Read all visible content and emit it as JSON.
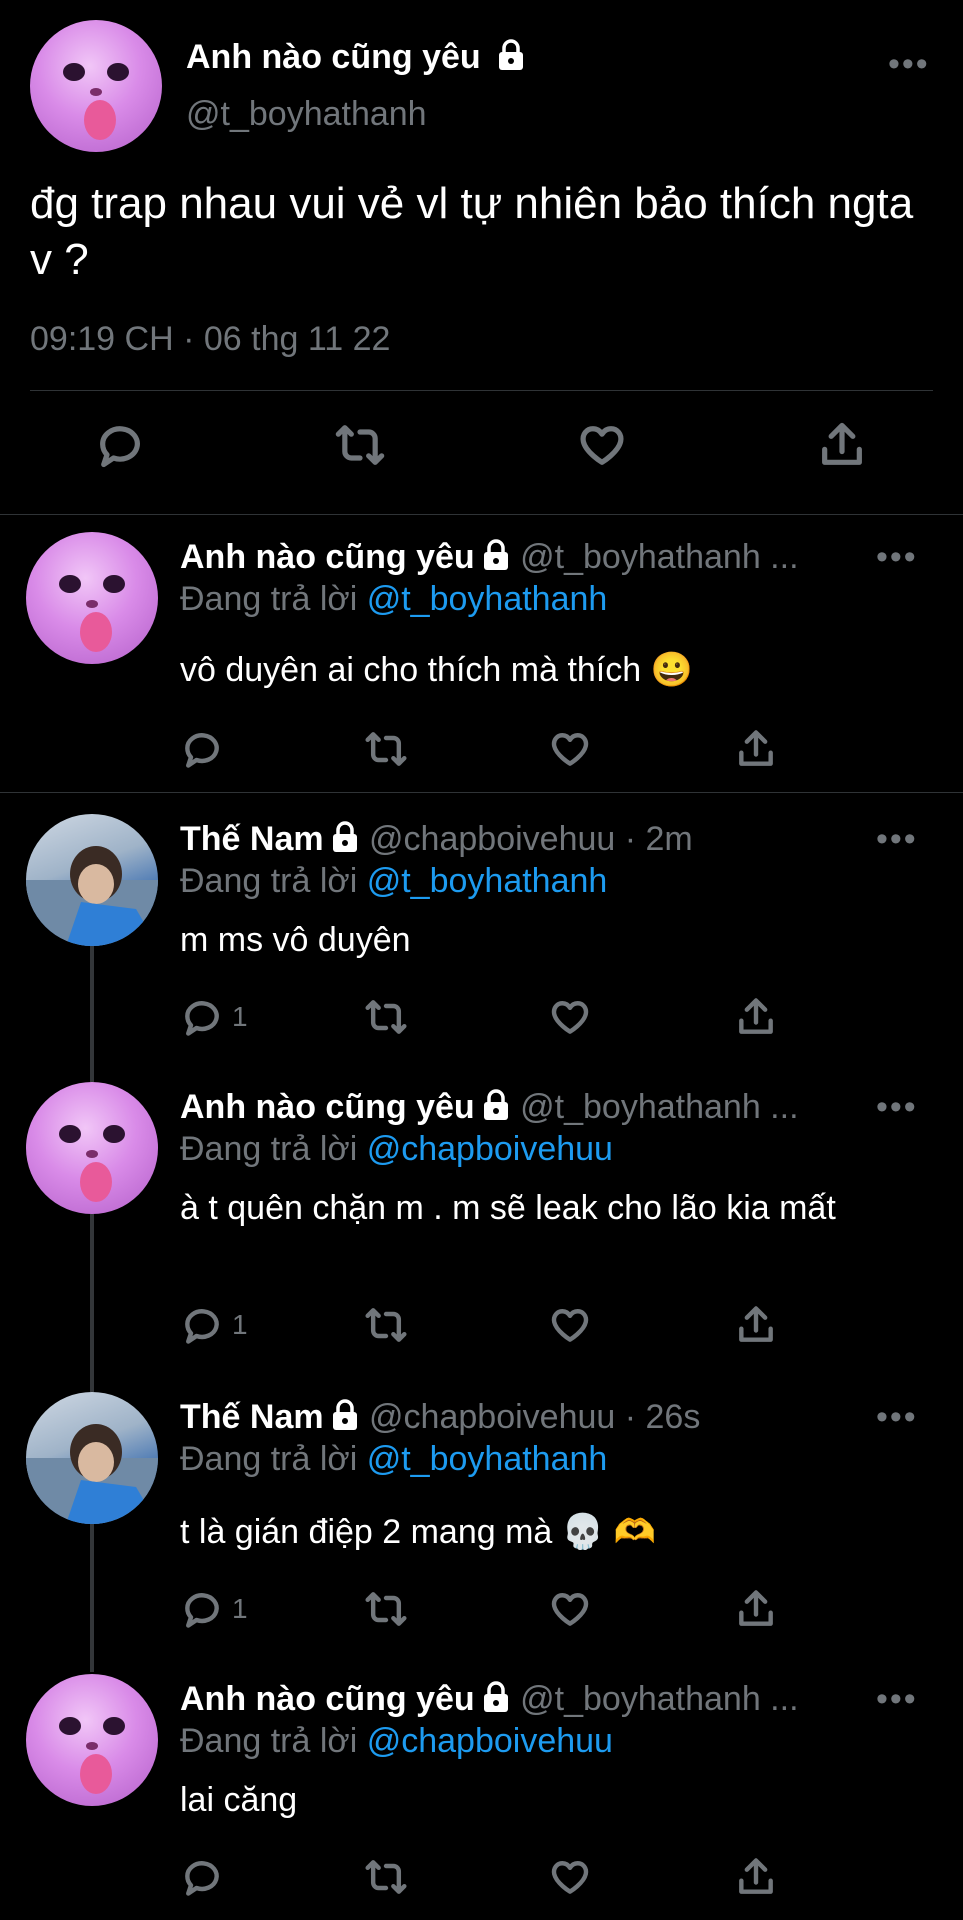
{
  "main_tweet": {
    "author_name": "Anh nào cũng yêu",
    "author_handle": "@t_boyhathanh",
    "text": "đg trap nhau vui vẻ vl tự nhiên bảo thích ngta v ?",
    "timestamp": "09:19 CH · 06 thg 11 22",
    "more": "•••"
  },
  "replies": [
    {
      "author_name": "Anh nào cũng yêu",
      "author_handle": "@t_boyhathanh ...",
      "time": "",
      "replying_prefix": "Đang trả lời",
      "replying_to": "@t_boyhathanh",
      "text": "vô duyên ai cho thích mà thích 😀",
      "reply_count": "",
      "more": "•••"
    },
    {
      "author_name": "Thế Nam",
      "author_handle": "@chapboivehuu · 2m",
      "replying_prefix": "Đang trả lời",
      "replying_to": "@t_boyhathanh",
      "text": "m ms vô duyên",
      "reply_count": "1",
      "more": "•••"
    },
    {
      "author_name": "Anh nào cũng yêu",
      "author_handle": "@t_boyhathanh ...",
      "replying_prefix": "Đang trả lời",
      "replying_to": "@chapboivehuu",
      "text": "à t quên chặn m . m sẽ leak cho lão kia mất",
      "reply_count": "1",
      "more": "•••"
    },
    {
      "author_name": "Thế Nam",
      "author_handle": "@chapboivehuu · 26s",
      "replying_prefix": "Đang trả lời",
      "replying_to": "@t_boyhathanh",
      "text": "t là gián điệp 2 mang mà 💀 🫶",
      "reply_count": "1",
      "more": "•••"
    },
    {
      "author_name": "Anh nào cũng yêu",
      "author_handle": "@t_boyhathanh ...",
      "replying_prefix": "Đang trả lời",
      "replying_to": "@chapboivehuu",
      "text": "lai căng",
      "reply_count": "",
      "more": "•••"
    }
  ],
  "icons": {
    "reply": "reply-icon",
    "retweet": "retweet-icon",
    "like": "heart-icon",
    "share": "share-icon",
    "lock": "lock-icon"
  },
  "colors": {
    "background": "#000000",
    "text": "#e7e9ea",
    "muted": "#71767b",
    "link": "#1d9bf0"
  }
}
